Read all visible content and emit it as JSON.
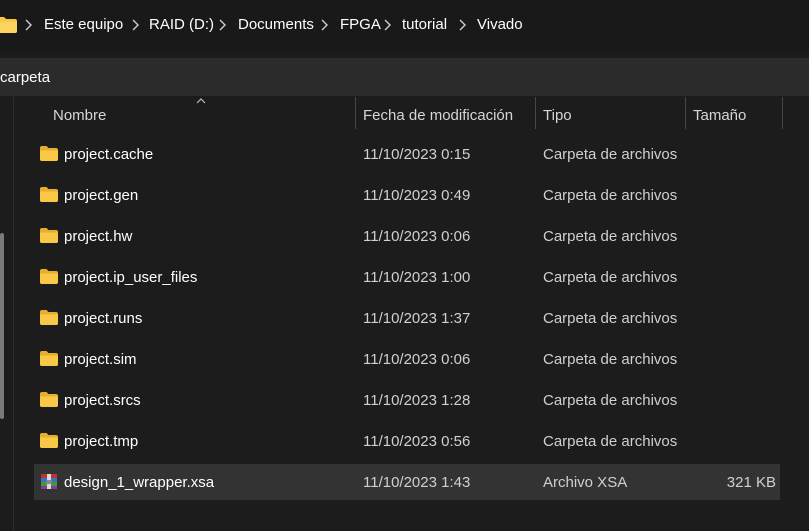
{
  "address_bar": {
    "breadcrumbs": [
      "Este equipo",
      "RAID (D:)",
      "Documents",
      "FPGA",
      "tutorial",
      "Vivado"
    ]
  },
  "command_bar": {
    "text": "carpeta"
  },
  "columns": {
    "name": "Nombre",
    "date": "Fecha de modificación",
    "type": "Tipo",
    "size": "Tamaño"
  },
  "files": [
    {
      "name": "project.cache",
      "date": "11/10/2023 0:15",
      "type": "Carpeta de archivos",
      "size": "",
      "icon": "folder-icon"
    },
    {
      "name": "project.gen",
      "date": "11/10/2023 0:49",
      "type": "Carpeta de archivos",
      "size": "",
      "icon": "folder-icon"
    },
    {
      "name": "project.hw",
      "date": "11/10/2023 0:06",
      "type": "Carpeta de archivos",
      "size": "",
      "icon": "folder-icon"
    },
    {
      "name": "project.ip_user_files",
      "date": "11/10/2023 1:00",
      "type": "Carpeta de archivos",
      "size": "",
      "icon": "folder-icon"
    },
    {
      "name": "project.runs",
      "date": "11/10/2023 1:37",
      "type": "Carpeta de archivos",
      "size": "",
      "icon": "folder-icon"
    },
    {
      "name": "project.sim",
      "date": "11/10/2023 0:06",
      "type": "Carpeta de archivos",
      "size": "",
      "icon": "folder-icon"
    },
    {
      "name": "project.srcs",
      "date": "11/10/2023 1:28",
      "type": "Carpeta de archivos",
      "size": "",
      "icon": "folder-icon"
    },
    {
      "name": "project.tmp",
      "date": "11/10/2023 0:56",
      "type": "Carpeta de archivos",
      "size": "",
      "icon": "folder-icon"
    },
    {
      "name": "design_1_wrapper.xsa",
      "date": "11/10/2023 1:43",
      "type": "Archivo XSA",
      "size": "321 KB",
      "icon": "archive-icon",
      "selected": true
    }
  ],
  "colors": {
    "background": "#1c1c1c",
    "selected_row": "#333333",
    "folder_yellow": "#f8c846"
  }
}
